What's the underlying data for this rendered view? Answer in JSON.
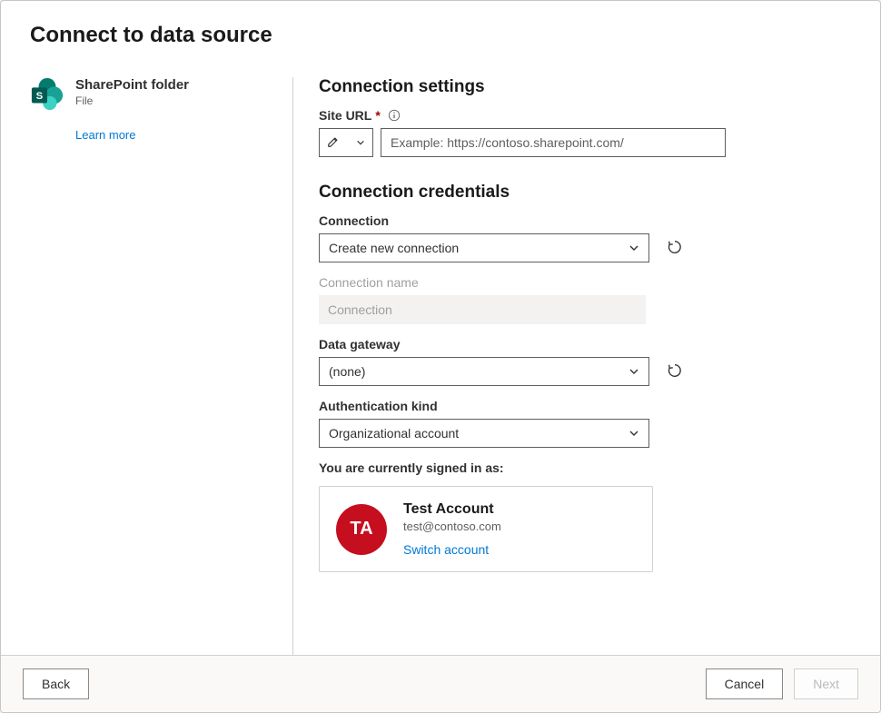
{
  "title": "Connect to data source",
  "source": {
    "name": "SharePoint folder",
    "subtitle": "File",
    "learn_more": "Learn more"
  },
  "settings": {
    "heading": "Connection settings",
    "site_url_label": "Site URL",
    "site_url_required": "*",
    "site_url_placeholder": "Example: https://contoso.sharepoint.com/"
  },
  "credentials": {
    "heading": "Connection credentials",
    "connection_label": "Connection",
    "connection_value": "Create new connection",
    "connection_name_label": "Connection name",
    "connection_name_value": "Connection",
    "gateway_label": "Data gateway",
    "gateway_value": "(none)",
    "auth_label": "Authentication kind",
    "auth_value": "Organizational account"
  },
  "signed_in": {
    "label": "You are currently signed in as:",
    "initials": "TA",
    "name": "Test Account",
    "email": "test@contoso.com",
    "switch": "Switch account"
  },
  "footer": {
    "back": "Back",
    "cancel": "Cancel",
    "next": "Next"
  }
}
